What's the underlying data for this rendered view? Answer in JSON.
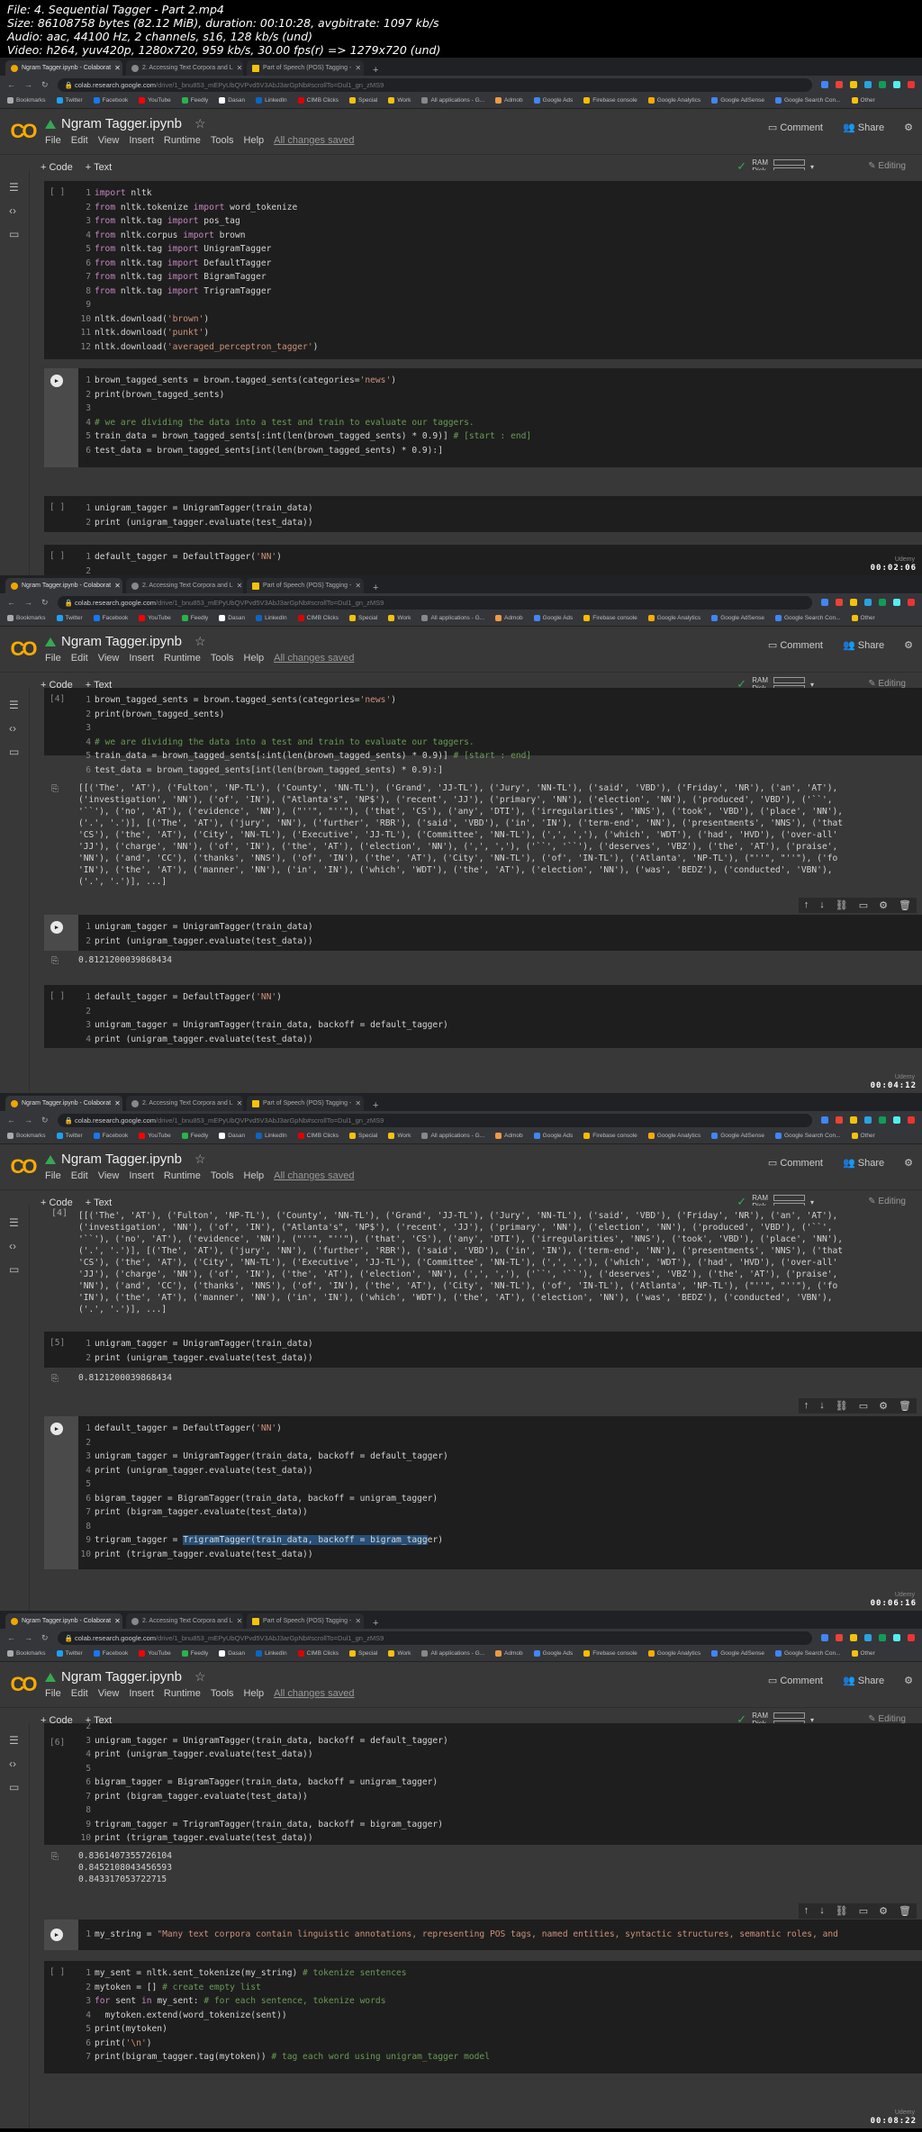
{
  "info": {
    "file": "File: 4. Sequential Tagger - Part 2.mp4",
    "size": "Size: 86108758 bytes (82.12 MiB), duration: 00:10:28, avgbitrate: 1097 kb/s",
    "audio": "Audio: aac, 44100 Hz, 2 channels, s16, 128 kb/s (und)",
    "video": "Video: h264, yuv420p, 1280x720, 959 kb/s, 30.00 fps(r) => 1279x720 (und)"
  },
  "browser": {
    "tabs": [
      "Ngram Tagger.ipynb - Colaborat",
      "2. Accessing Text Corpora and L",
      "Part of Speech (POS) Tagging - "
    ],
    "url_host": "colab.research.google.com",
    "url_rest": "/drive/1_bnu853_mEPyUbQVPvd5V3AbJ3arGpNb#scrollTo=Dul1_gn_zMS9",
    "bookmarks": [
      "Bookmarks",
      "Twitter",
      "Facebook",
      "YouTube",
      "Feedly",
      "Dasan",
      "LinkedIn",
      "CIMB Clicks",
      "Special",
      "Work",
      "All applications - G...",
      "Admob",
      "Google Ads",
      "Firebase console",
      "Google Analytics",
      "Google AdSense",
      "Google Search Con...",
      "Other"
    ]
  },
  "colab": {
    "notebook_title": "Ngram Tagger.ipynb",
    "menu": [
      "File",
      "Edit",
      "View",
      "Insert",
      "Runtime",
      "Tools",
      "Help"
    ],
    "saved_status": "All changes saved",
    "comment": "Comment",
    "share": "Share",
    "add_code": "+ Code",
    "add_text": "+ Text",
    "ram": "RAM",
    "disk": "Disk",
    "editing": "Editing",
    "watermark": "Udemy"
  },
  "frames": [
    {
      "timestamp": "00:02:06"
    },
    {
      "timestamp": "00:04:12"
    },
    {
      "timestamp": "00:06:16"
    },
    {
      "timestamp": "00:08:22"
    }
  ],
  "outputs": {
    "sents": "[[('The', 'AT'), ('Fulton', 'NP-TL'), ('County', 'NN-TL'), ('Grand', 'JJ-TL'), ('Jury', 'NN-TL'), ('said', 'VBD'), ('Friday', 'NR'), ('an', 'AT'),\n('investigation', 'NN'), ('of', 'IN'), (\"Atlanta's\", 'NP$'), ('recent', 'JJ'), ('primary', 'NN'), ('election', 'NN'), ('produced', 'VBD'), ('``',\n'``'), ('no', 'AT'), ('evidence', 'NN'), (\"''\", \"''\"), ('that', 'CS'), ('any', 'DTI'), ('irregularities', 'NNS'), ('took', 'VBD'), ('place', 'NN'),\n('.', '.')], [('The', 'AT'), ('jury', 'NN'), ('further', 'RBR'), ('said', 'VBD'), ('in', 'IN'), ('term-end', 'NN'), ('presentments', 'NNS'), ('that\n'CS'), ('the', 'AT'), ('City', 'NN-TL'), ('Executive', 'JJ-TL'), ('Committee', 'NN-TL'), (',', ','), ('which', 'WDT'), ('had', 'HVD'), ('over-all'\n'JJ'), ('charge', 'NN'), ('of', 'IN'), ('the', 'AT'), ('election', 'NN'), (',', ','), ('``', '``'), ('deserves', 'VBZ'), ('the', 'AT'), ('praise',\n'NN'), ('and', 'CC'), ('thanks', 'NNS'), ('of', 'IN'), ('the', 'AT'), ('City', 'NN-TL'), ('of', 'IN-TL'), ('Atlanta', 'NP-TL'), (\"''\", \"''\"), ('fo\n'IN'), ('the', 'AT'), ('manner', 'NN'), ('in', 'IN'), ('which', 'WDT'), ('the', 'AT'), ('election', 'NN'), ('was', 'BEDZ'), ('conducted', 'VBN'),\n('.', '.')], ...]",
    "unigram": "0.8121200039868434",
    "three": "0.8361407355726104\n0.8452108043456593\n0.843317053722715"
  },
  "cells": {
    "c5": "[5]",
    "c4": "[4]",
    "c6": "[6]"
  }
}
